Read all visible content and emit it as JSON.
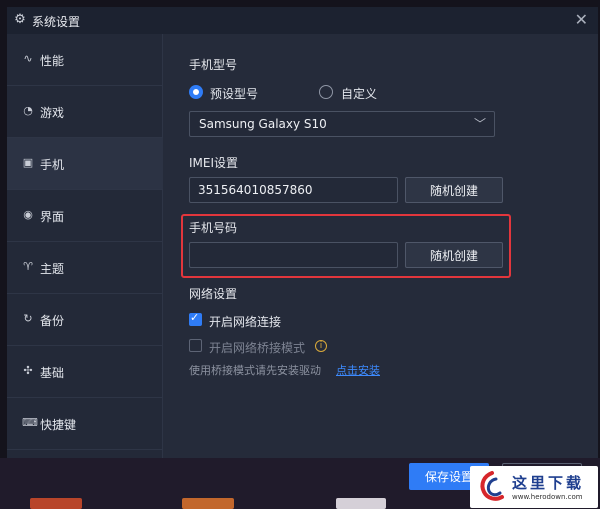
{
  "window": {
    "title": "系统设置",
    "close": "✕"
  },
  "sidebar": {
    "items": [
      {
        "label": "性能",
        "icon": "pulse-icon",
        "glyph": "∿"
      },
      {
        "label": "游戏",
        "icon": "gamepad-icon",
        "glyph": "◔"
      },
      {
        "label": "手机",
        "icon": "phone-icon",
        "glyph": "▣"
      },
      {
        "label": "界面",
        "icon": "palette-icon",
        "glyph": "◉"
      },
      {
        "label": "主题",
        "icon": "shirt-icon",
        "glyph": "♈"
      },
      {
        "label": "备份",
        "icon": "restore-icon",
        "glyph": "↻"
      },
      {
        "label": "基础",
        "icon": "puzzle-icon",
        "glyph": "✣"
      },
      {
        "label": "快捷键",
        "icon": "keyboard-icon",
        "glyph": "⌨"
      }
    ],
    "active_index": 2
  },
  "phone_model": {
    "title": "手机型号",
    "options": [
      {
        "label": "预设型号",
        "selected": true
      },
      {
        "label": "自定义",
        "selected": false
      }
    ],
    "selected_model": "Samsung Galaxy S10",
    "chevron": "﹀"
  },
  "imei": {
    "title": "IMEI设置",
    "value": "351564010857860",
    "button": "随机创建"
  },
  "phone_number": {
    "title": "手机号码",
    "value": "",
    "button": "随机创建"
  },
  "network": {
    "title": "网络设置",
    "options": [
      {
        "label": "开启网络连接",
        "checked": true
      },
      {
        "label": "开启网络桥接模式",
        "checked": false
      }
    ],
    "info_glyph": "i",
    "hint": "使用桥接模式请先安装驱动",
    "link": "点击安装"
  },
  "footer": {
    "save": "保存设置",
    "cancel": ""
  },
  "watermark": {
    "brand": "这里下载",
    "url": "www.herodown.com"
  },
  "colors": {
    "accent": "#2f7cf6",
    "highlight": "#e2363c",
    "link": "#3d8bff",
    "warning": "#d9a93a"
  }
}
